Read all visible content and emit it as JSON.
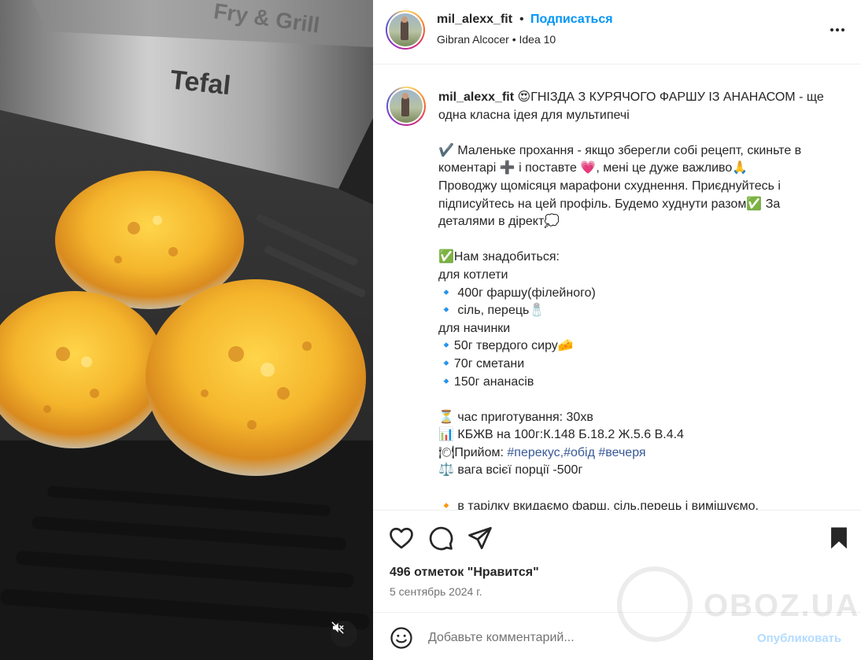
{
  "media": {
    "brand_text": "Tefal",
    "lid_text": "Fry & Grill",
    "mute_icon": "speaker-muted-icon"
  },
  "header": {
    "username": "mil_alexx_fit",
    "separator": "•",
    "follow_label": "Подписаться",
    "subtitle": "Gibran Alcocer • Idea 10",
    "more_icon": "more-horizontal-icon"
  },
  "caption": {
    "username": "mil_alexx_fit",
    "lines": [
      {
        "emoji": "😍",
        "text": "ГНІЗДА З КУРЯЧОГО ФАРШУ ІЗ АНАНАСОМ - ще"
      },
      {
        "text": "одна класна ідея для мультипечі"
      },
      {
        "text": ""
      },
      {
        "emoji": "✔️",
        "text": " Маленьке прохання - якщо зберегли собі рецепт, скиньте в"
      },
      {
        "text_a": "коментарі ",
        "emoji_a": "➕",
        "text_b": " і поставте ",
        "emoji_b": "💗",
        "text_c": ", мені це дуже важливо",
        "emoji_c": "🙏"
      },
      {
        "text": "Проводжу щомісяця марафони схуднення. Приєднуйтесь і"
      },
      {
        "text_a": "підписуйтесь на цей профіль. Будемо худнути разом",
        "emoji_a": "✅",
        "text_b": " За"
      },
      {
        "text_a": "деталями в дірект",
        "emoji_a": "💭"
      },
      {
        "text": ""
      },
      {
        "emoji": "✅",
        "text": "Нам знадобиться:"
      },
      {
        "text": "для котлети"
      },
      {
        "emoji": "🔹",
        "text": " 400г фаршу(філейного)"
      },
      {
        "emoji": "🔹",
        "text": " сіль, перець",
        "emoji_end": "🧂"
      },
      {
        "text": "для начинки"
      },
      {
        "emoji": "🔹",
        "text": "50г твердого сиру",
        "emoji_end": "🧀"
      },
      {
        "emoji": "🔹",
        "text": "70г сметани"
      },
      {
        "emoji": "🔹",
        "text": "150г ананасів"
      },
      {
        "text": ""
      },
      {
        "emoji": "⏳",
        "text": " час приготування: 30хв"
      },
      {
        "emoji": "📊",
        "text": " КБЖВ на 100г:К.148 Б.18.2 Ж.5.6 В.4.4"
      },
      {
        "emoji": "🍽",
        "text": "Прийом: ",
        "tags": [
          "#перекус",
          ",#обід",
          " #вечеря"
        ]
      },
      {
        "emoji": "⚖️",
        "text": " вага всієї порції -500г"
      },
      {
        "text": ""
      },
      {
        "emoji": "🔸",
        "text": " в тарілку вкидаємо фарш, сіль,перець і вимішуємо."
      }
    ]
  },
  "actions": {
    "like_icon": "heart-icon",
    "comment_icon": "comment-icon",
    "share_icon": "share-icon",
    "save_icon": "bookmark-icon",
    "likes_text": "496 отметок \"Нравится\"",
    "date_text": "5 сентябрь 2024 г."
  },
  "comment": {
    "emoji_icon": "smiley-icon",
    "placeholder": "Добавьте комментарий...",
    "publish_label": "Опубликовать"
  },
  "watermark": {
    "text": "OBOZ.UA"
  },
  "colors": {
    "link": "#0095f6",
    "hashtag": "#385898",
    "text": "#262626",
    "muted": "#737373",
    "publish_disabled": "#b3dbff"
  }
}
